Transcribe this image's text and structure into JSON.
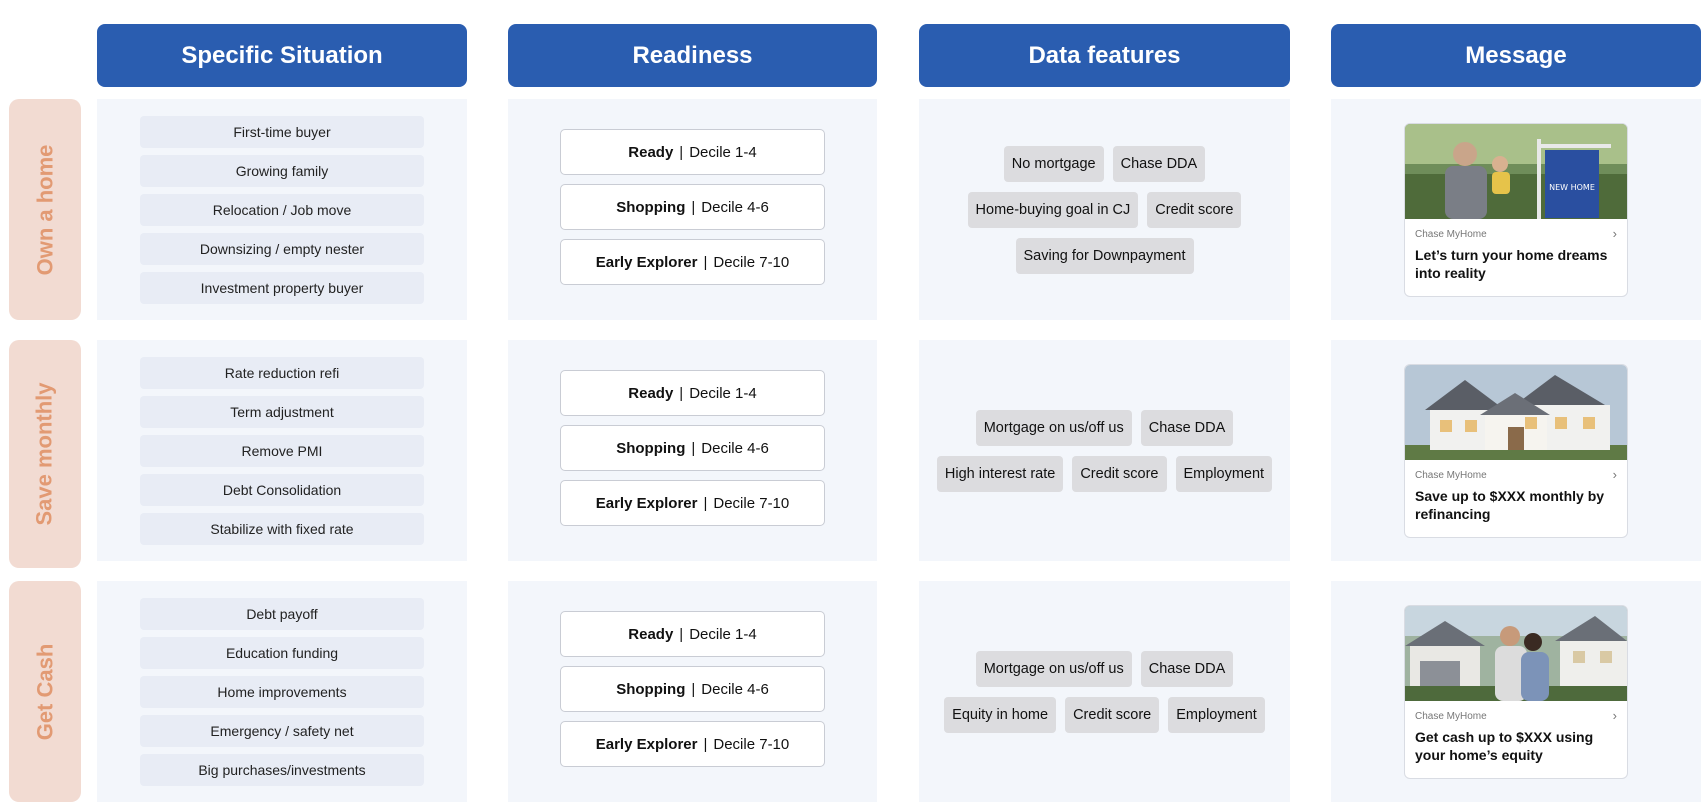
{
  "headers": {
    "situation": "Specific Situation",
    "readiness": "Readiness",
    "features": "Data features",
    "message": "Message"
  },
  "rows": [
    {
      "label": "Own a home",
      "situations": [
        "First-time buyer",
        "Growing family",
        "Relocation / Job move",
        "Downsizing / empty nester",
        "Investment property buyer"
      ],
      "readiness": [
        {
          "name": "Ready",
          "decile": "Decile  1-4"
        },
        {
          "name": "Shopping",
          "decile": "Decile  4-6"
        },
        {
          "name": "Early Explorer",
          "decile": "Decile  7-10"
        }
      ],
      "features": [
        [
          "No mortgage",
          "Chase DDA"
        ],
        [
          "Home-buying goal in CJ",
          "Credit score"
        ],
        [
          "Saving for Downpayment"
        ]
      ],
      "message": {
        "brand": "Chase MyHome",
        "text": "Let’s turn your home dreams into reality",
        "sign_text": "NEW HOME"
      }
    },
    {
      "label": "Save monthly",
      "situations": [
        "Rate reduction refi",
        "Term adjustment",
        "Remove PMI",
        "Debt Consolidation",
        "Stabilize with fixed rate"
      ],
      "readiness": [
        {
          "name": "Ready",
          "decile": "Decile  1-4"
        },
        {
          "name": "Shopping",
          "decile": "Decile  4-6"
        },
        {
          "name": "Early Explorer",
          "decile": "Decile  7-10"
        }
      ],
      "features": [
        [
          "Mortgage on us/off us",
          "Chase DDA"
        ],
        [
          "High interest rate",
          "Credit score",
          "Employment"
        ]
      ],
      "message": {
        "brand": "Chase MyHome",
        "text": "Save up to $XXX monthly by refinancing"
      }
    },
    {
      "label": "Get Cash",
      "situations": [
        "Debt payoff",
        "Education funding",
        "Home improvements",
        "Emergency / safety net",
        "Big purchases/investments"
      ],
      "readiness": [
        {
          "name": "Ready",
          "decile": "Decile  1-4"
        },
        {
          "name": "Shopping",
          "decile": "Decile  4-6"
        },
        {
          "name": "Early Explorer",
          "decile": "Decile  7-10"
        }
      ],
      "features": [
        [
          "Mortgage on us/off us",
          "Chase DDA"
        ],
        [
          "Equity in home",
          "Credit score",
          "Employment"
        ]
      ],
      "message": {
        "brand": "Chase MyHome",
        "text": "Get cash up to $XXX using your home’s equity"
      }
    }
  ],
  "colors": {
    "header": "#2a5db0",
    "row_label_bg": "#f2dbd2",
    "row_label_text": "#e29a73",
    "panel": "#f3f6fb"
  },
  "icons": {
    "card_arrow": "chevron-right-icon"
  }
}
